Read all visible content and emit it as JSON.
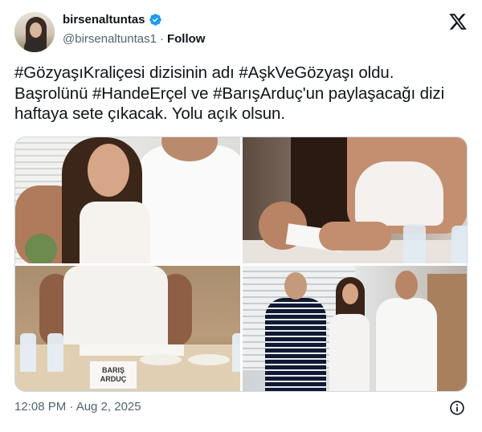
{
  "author": {
    "display_name": "birsenaltuntas",
    "handle": "@birsenaltuntas1",
    "separator": "·",
    "follow_label": "Follow",
    "avatar_icon": "profile-photo",
    "verified_icon": "verified-badge-icon",
    "verified_color": "#1d9bf0"
  },
  "platform_icon": "x-logo-icon",
  "tweet": {
    "text_lines": [
      "#GözyaşıKraliçesi dizisinin adı #AşkVeGözyaşı oldu.",
      "Başrolünü #HandeErçel ve #BarışArduç'un paylaşacağı dizi",
      "haftaya sete çıkacak. Yolu açık olsun."
    ]
  },
  "media": {
    "photos": [
      {
        "description": "photo-1"
      },
      {
        "description": "photo-2"
      },
      {
        "description": "photo-3",
        "name_card_lines": [
          "BARIŞ",
          "ARDUÇ"
        ]
      },
      {
        "description": "photo-4"
      }
    ]
  },
  "footer": {
    "timestamp": "12:08 PM · Aug 2, 2025",
    "info_icon": "info-icon"
  },
  "colors": {
    "text_primary": "#0f1419",
    "text_secondary": "#536471",
    "border": "#cfd9de"
  }
}
